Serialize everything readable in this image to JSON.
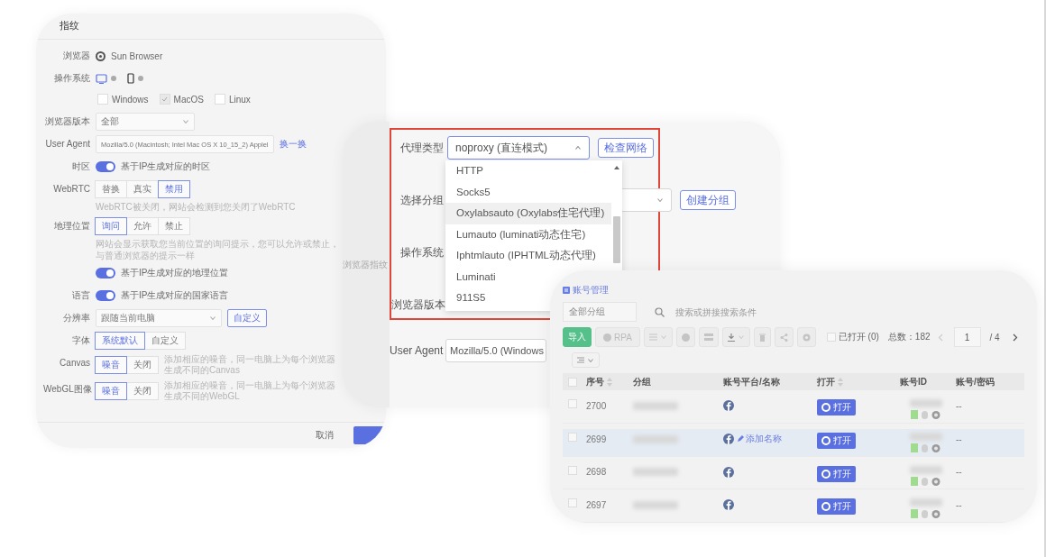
{
  "fingerprint_panel": {
    "title": "指纹",
    "rows": [
      {
        "kind": "browser",
        "label": "浏览器",
        "value": "Sun Browser"
      },
      {
        "kind": "os",
        "label": "操作系统",
        "devices": [
          {
            "kind": "desktop",
            "selected": true
          },
          {
            "kind": "mobile",
            "selected": false
          }
        ],
        "options": [
          {
            "label": "Windows",
            "checked": false
          },
          {
            "label": "MacOS",
            "checked": true
          },
          {
            "label": "Linux",
            "checked": false
          }
        ]
      },
      {
        "kind": "select",
        "label": "浏览器版本",
        "value": "全部"
      },
      {
        "kind": "input",
        "label": "User Agent",
        "value": "Mozilla/5.0 (Macintosh; Intel Mac OS X 10_15_2) Applel",
        "link": "换一换"
      },
      {
        "kind": "toggle",
        "label": "时区",
        "on": true,
        "text": "基于IP生成对应的时区"
      },
      {
        "kind": "segmented",
        "label": "WebRTC",
        "options": [
          {
            "label": "替换",
            "selected": false
          },
          {
            "label": "真实",
            "selected": false
          },
          {
            "label": "禁用",
            "selected": true
          }
        ],
        "hint": "WebRTC被关闭，网站会检测到您关闭了WebRTC"
      },
      {
        "kind": "segmented",
        "label": "地理位置",
        "options": [
          {
            "label": "询问",
            "selected": true
          },
          {
            "label": "允许",
            "selected": false
          },
          {
            "label": "禁止",
            "selected": false
          }
        ],
        "hint": "网站会显示获取您当前位置的询问提示，您可以允许或禁止，与普通浏览器的提示一样",
        "toggle": {
          "on": true,
          "text": "基于IP生成对应的地理位置"
        }
      },
      {
        "kind": "toggle",
        "label": "语言",
        "on": true,
        "text": "基于IP生成对应的国家语言"
      },
      {
        "kind": "select",
        "label": "分辨率",
        "value": "跟随当前电脑",
        "button": "自定义"
      },
      {
        "kind": "segmented",
        "label": "字体",
        "options": [
          {
            "label": "系统默认",
            "selected": true
          },
          {
            "label": "自定义",
            "selected": false
          }
        ]
      },
      {
        "kind": "segmented",
        "label": "Canvas",
        "options": [
          {
            "label": "噪音",
            "selected": true
          },
          {
            "label": "关闭",
            "selected": false
          }
        ],
        "note": "添加相应的噪音，同一电脑上为每个浏览器生成不同的Canvas"
      },
      {
        "kind": "segmented",
        "label": "WebGL图像",
        "options": [
          {
            "label": "噪音",
            "selected": true
          },
          {
            "label": "关闭",
            "selected": false
          }
        ],
        "note": "添加相应的噪音，同一电脑上为每个浏览器生成不同的WebGL"
      }
    ],
    "cancel": "取消"
  },
  "proxy_panel": {
    "section": "浏览器指纹",
    "rows": [
      {
        "kind": "select",
        "label": "代理类型",
        "value": "noproxy (直连模式)",
        "button": "检查网络",
        "expanded": true
      },
      {
        "kind": "select",
        "label": "选择分组",
        "button": "创建分组",
        "expanded": false
      },
      {
        "kind": "blank",
        "label": "操作系统"
      },
      {
        "kind": "blank",
        "label": "浏览器版本"
      },
      {
        "kind": "input",
        "label": "User Agent",
        "value": "Mozilla/5.0 (Windows"
      }
    ],
    "options": [
      {
        "label": "HTTP",
        "hovered": false
      },
      {
        "label": "Socks5",
        "hovered": false
      },
      {
        "label": "Oxylabsauto (Oxylabs住宅代理)",
        "hovered": true
      },
      {
        "label": "Lumauto (luminati动态住宅)",
        "hovered": false
      },
      {
        "label": "Iphtmlauto (IPHTML动态代理)",
        "hovered": false
      },
      {
        "label": "Luminati",
        "hovered": false
      },
      {
        "label": "911S5",
        "hovered": false
      }
    ]
  },
  "accounts_panel": {
    "title": "账号管理",
    "group_select": "全部分组",
    "search": {
      "placeholder": "搜索或拼接搜索条件"
    },
    "toolbar": {
      "import": "导入",
      "rpa": "RPA"
    },
    "opened_filter": {
      "label": "已打开 (0)",
      "checked": false
    },
    "total": "总数：182",
    "page": "1",
    "page_count": "/ 4",
    "all_checked": false,
    "columns": [
      {
        "label": "序号",
        "sortable": true
      },
      {
        "label": "分组",
        "sortable": false
      },
      {
        "label": "账号平台/名称",
        "sortable": false
      },
      {
        "label": "打开",
        "sortable": true
      },
      {
        "label": "账号ID",
        "sortable": false
      },
      {
        "label": "账号/密码",
        "sortable": false
      }
    ],
    "rows": [
      {
        "number": "2700",
        "open": "打开",
        "credentials": "--",
        "selected": false,
        "checked": false
      },
      {
        "number": "2699",
        "add_name": "添加名称",
        "open": "打开",
        "credentials": "--",
        "selected": true,
        "checked": false
      },
      {
        "number": "2698",
        "open": "打开",
        "credentials": "--",
        "selected": false,
        "checked": false
      },
      {
        "number": "2697",
        "open": "打开",
        "credentials": "--",
        "selected": false,
        "checked": false
      }
    ]
  }
}
